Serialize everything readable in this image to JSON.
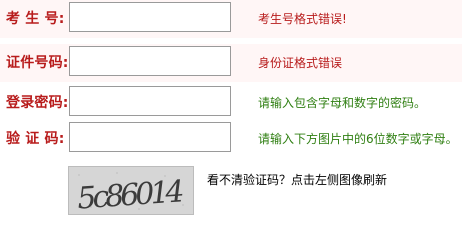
{
  "fields": [
    {
      "label": "考 生 号:",
      "value": "",
      "message": "考生号格式错误!",
      "message_color": "#b81c1c"
    },
    {
      "label": "证件号码:",
      "value": "",
      "message": "身份证格式错误",
      "message_color": "#b81c1c"
    },
    {
      "label": "登录密码:",
      "value": "",
      "message": "请输入包含字母和数字的密码。",
      "message_color": "#2f7f12"
    },
    {
      "label": "验 证 码:",
      "value": "",
      "message": "请输入下方图片中的6位数字或字母。",
      "message_color": "#2f7f12"
    }
  ],
  "captcha": {
    "text": "5c86014"
  },
  "refresh_text": "看不清验证码？点击左侧图像刷新",
  "colors": {
    "row_background": "#fff6f6",
    "label": "#b81c1c"
  }
}
